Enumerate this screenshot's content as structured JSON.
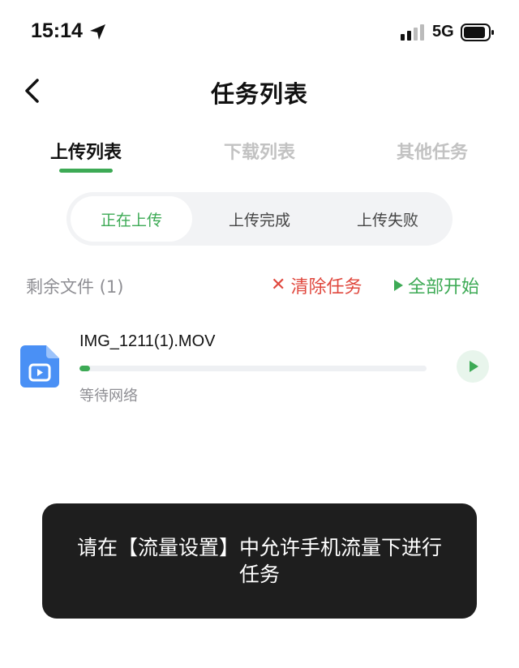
{
  "status_bar": {
    "time": "15:14",
    "network": "5G",
    "icons": [
      "location-arrow-icon",
      "signal-icon",
      "battery-icon"
    ]
  },
  "nav": {
    "title": "任务列表",
    "back_icon": "chevron-left-icon"
  },
  "main_tabs": [
    {
      "label": "上传列表",
      "active": true
    },
    {
      "label": "下载列表",
      "active": false
    },
    {
      "label": "其他任务",
      "active": false
    }
  ],
  "segments": [
    {
      "label": "正在上传",
      "active": true
    },
    {
      "label": "上传完成",
      "active": false
    },
    {
      "label": "上传失败",
      "active": false
    }
  ],
  "summary": {
    "remaining": "剩余文件 (1)",
    "clear_label": "清除任务",
    "start_all_label": "全部开始"
  },
  "files": [
    {
      "name": "IMG_1211(1).MOV",
      "status": "等待网络",
      "progress": 0.03,
      "icon": "video-file-icon"
    }
  ],
  "toast": {
    "message": "请在【流量设置】中允许手机流量下进行任务"
  },
  "colors": {
    "accent": "#3daa55",
    "danger": "#e0483e",
    "muted": "#8e8e93",
    "toast_bg": "#1e1e1e",
    "file_icon": "#4a90f5"
  }
}
